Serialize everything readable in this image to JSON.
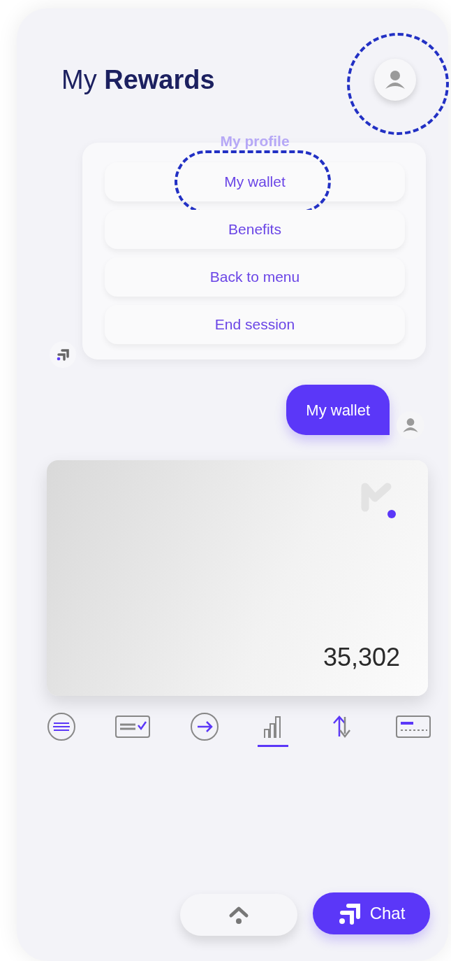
{
  "header": {
    "title_light": "My",
    "title_bold": "Rewards"
  },
  "menu": {
    "items": [
      {
        "label": "My profile",
        "faded": true,
        "highlighted": false
      },
      {
        "label": "My wallet",
        "faded": false,
        "highlighted": true
      },
      {
        "label": "Benefits",
        "faded": false,
        "highlighted": false
      },
      {
        "label": "Back to menu",
        "faded": false,
        "highlighted": false
      },
      {
        "label": "End session",
        "faded": false,
        "highlighted": false
      }
    ]
  },
  "user_message": {
    "text": "My wallet"
  },
  "wallet_card": {
    "balance": "35,302"
  },
  "wallet_actions": [
    {
      "selected": false
    },
    {
      "selected": false
    },
    {
      "selected": false
    },
    {
      "selected": true
    },
    {
      "selected": false
    },
    {
      "selected": false
    }
  ],
  "avatar_highlighted": true,
  "chat_button": {
    "label": "Chat"
  }
}
